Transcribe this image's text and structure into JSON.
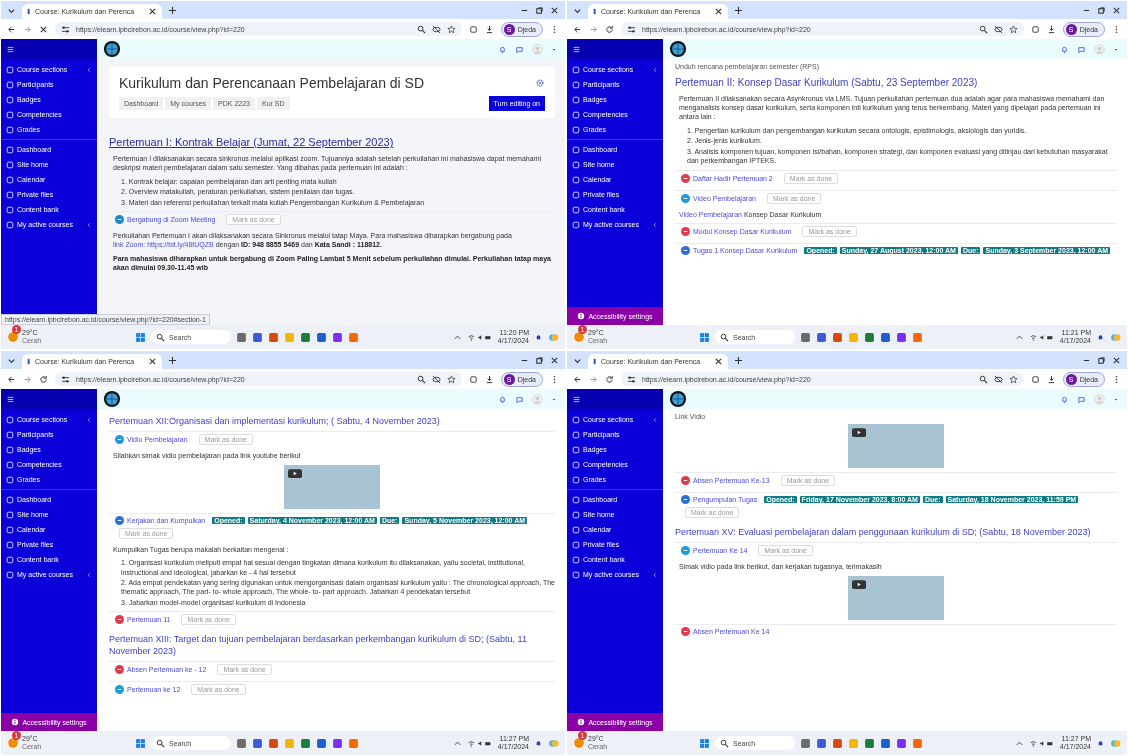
{
  "screens": [
    {
      "tab_title": "Course: Kurikulum dan Perenca",
      "loading": true,
      "url": "https://elearn.ipbcirebon.ac.id/course/view.php?id=220",
      "profile_initial": "S",
      "profile": "Djeda",
      "sidebar": [
        {
          "label": "Course sections",
          "expandable": true
        },
        {
          "label": "Participants",
          "expandable": false
        },
        {
          "label": "Badges",
          "expandable": false
        },
        {
          "label": "Competencies",
          "expandable": false
        },
        {
          "label": "Grades",
          "expandable": false
        },
        {
          "label": "Dashboard",
          "expandable": false
        },
        {
          "label": "Site home",
          "expandable": false
        },
        {
          "label": "Calendar",
          "expandable": false
        },
        {
          "label": "Private files",
          "expandable": false
        },
        {
          "label": "Content bank",
          "expandable": false
        },
        {
          "label": "My active courses",
          "expandable": true
        }
      ],
      "blocks": [
        {
          "kind": "course-header",
          "title": "Kurikulum dan Perencanaan Pembelajaran di SD",
          "breadcrumbs": [
            "Dashboard",
            "My courses",
            "PDK 2223",
            "Kur SD"
          ],
          "button": "Turn editing on"
        },
        {
          "kind": "section-title",
          "text": "Pertemuan I: Kontrak Belajar (Jumat, 22 September 2023)",
          "underlined": true
        },
        {
          "kind": "paragraph",
          "parts": [
            {
              "text": "Pertemuan I dilaksanakan secara sinkronus melalui aplikasi zoom. Tujuannya adalah setelah perkuliahan ini mahasiswa dapat memahami deskripsi materi pembelajaran dalam satu semester. Yang dibahas pada pertemuan ini adalah :",
              "kind": "plain"
            }
          ]
        },
        {
          "kind": "list",
          "items": [
            {
              "number": "1.",
              "text": "Kontrak belajar: capaian pembelajaran dan arti penting mata kuliah"
            },
            {
              "number": "2.",
              "text": "Overview matakuliah, peraturan perkuliahan, sistem penilaian dan tugas."
            },
            {
              "number": "3.",
              "text": "Materi dan referensi perkuliahan terkait mata kuliah Pengembangan Kurikulum & Pembelajaran"
            }
          ]
        },
        {
          "kind": "activity",
          "name": "Bergabung di Zoom Meeting",
          "color": "#1e88c9",
          "mark_done": "Mark as done"
        },
        {
          "kind": "paragraph",
          "parts": [
            {
              "text": "Perkuliahan Pertemuan I akan dilaksanakan secara Sinkronus melalui tatap Maya. Para mahasiswa diharapkan bergabung pada",
              "kind": "plain"
            },
            {
              "text": "link Zoom: https://bit.ly/48tUQZB",
              "kind": "link"
            },
            {
              "text": "dengan",
              "kind": "plain"
            },
            {
              "text": "ID: 948 8855 5469",
              "kind": "bold"
            },
            {
              "text": "dan",
              "kind": "plain"
            },
            {
              "text": "Kata Sandi : 118812.",
              "kind": "bold"
            }
          ]
        },
        {
          "kind": "paragraph",
          "parts": [
            {
              "text": "Para mahasiswa diharapkan untuk bergabung di Zoom Paling Lambat 5 Menit sebelum perkuliahan dimulai. Perkuliahan tatap maya akan dimulai 09.30-11.45 wib",
              "kind": "bold"
            }
          ]
        }
      ],
      "status_url": "https://elearn.ipbcirebon.ac.id/course/view.php?id=220#section-1",
      "taskbar": {
        "weather_badge": "1",
        "temp": "29°C",
        "weather": "Cerah",
        "search": "Search",
        "time": "11:20 PM",
        "date": "4/17/2024"
      }
    },
    {
      "tab_title": "Course: Kurikulum dan Perenca",
      "loading": false,
      "url": "https://elearn.ipbcirebon.ac.id/course/view.php?id=220",
      "profile_initial": "S",
      "profile": "Djeda",
      "sidebar": [
        {
          "label": "Course sections",
          "expandable": true
        },
        {
          "label": "Participants",
          "expandable": false
        },
        {
          "label": "Badges",
          "expandable": false
        },
        {
          "label": "Competencies",
          "expandable": false
        },
        {
          "label": "Grades",
          "expandable": false
        },
        {
          "label": "Dashboard",
          "expandable": false
        },
        {
          "label": "Site home",
          "expandable": false
        },
        {
          "label": "Calendar",
          "expandable": false
        },
        {
          "label": "Private files",
          "expandable": false
        },
        {
          "label": "Content bank",
          "expandable": false
        },
        {
          "label": "My active courses",
          "expandable": true
        }
      ],
      "accessibility": "Accessibility settings",
      "blocks": [
        {
          "kind": "cut-line",
          "text": "Unduh rencana pembelajaran semester (RPS)"
        },
        {
          "kind": "section-title",
          "text": "Pertemuan II: Konsep Dasar Kurikulum (Sabtu, 23 September 2023)",
          "underlined": false
        },
        {
          "kind": "paragraph",
          "parts": [
            {
              "text": "Pertemuan II dilaksanakan secara Asynkronus via LMS. Tujuan perkuliahan pertemuan dua adalah agar para mahasiswa memahami dan menganalisis konsep dasar kurikulum, serta komponen inti kurikulum yang terus berkembang. Materi yang dipelajari pada pertemuan ini antara lain :",
              "kind": "plain"
            }
          ]
        },
        {
          "kind": "list",
          "items": [
            {
              "number": "1.",
              "text": "Pengertian kurikulum dan pengembangan kurikulum secara ontologis, epistimologis, aksiologis dan yuridis."
            },
            {
              "number": "2.",
              "text": "Jenis-jenis kurikulum."
            },
            {
              "number": "3.",
              "text": "Analisis komponen tujuan, komponen isi/bahan, komponen strategi, dan komponen evaluasi yang ditinjau dari kebutuhan masyarakat dan perkembangan IPTEKS."
            }
          ]
        },
        {
          "kind": "activity",
          "name": "Daftar Hadir Pertemuan 2",
          "color": "#e2394c",
          "mark_done": "Mark as done"
        },
        {
          "kind": "activity",
          "name": "Video Pembelajaran",
          "color": "#1e9bd7",
          "mark_done": "Mark as done"
        },
        {
          "kind": "paragraph",
          "parts": [
            {
              "text": "Video Pembelajaran",
              "kind": "link"
            },
            {
              "text": "Konsep Dasar Kurikulum",
              "kind": "plain"
            }
          ]
        },
        {
          "kind": "activity",
          "name": "Modul Konsep Dasar Kurikulum",
          "color": "#e2394c",
          "mark_done": "Mark as done"
        },
        {
          "kind": "activity",
          "name": "Tugas 1 Konsep Dasar Kurikulum",
          "color": "#2a6fd6",
          "dates": [
            {
              "label": "Opened:",
              "value": "Sunday, 27 August 2023, 12:00 AM"
            },
            {
              "label": "Due:",
              "value": "Sunday, 3 September 2023, 12:00 AM"
            }
          ]
        }
      ],
      "taskbar": {
        "weather_badge": "1",
        "temp": "29°C",
        "weather": "Cerah",
        "search": "Search",
        "time": "11:21 PM",
        "date": "4/17/2024"
      }
    },
    {
      "tab_title": "Course: Kurikulum dan Perenca",
      "loading": false,
      "url": "https://elearn.ipbcirebon.ac.id/course/view.php?id=220",
      "profile_initial": "S",
      "profile": "Djeda",
      "sidebar": [
        {
          "label": "Course sections",
          "expandable": true
        },
        {
          "label": "Participants",
          "expandable": false
        },
        {
          "label": "Badges",
          "expandable": false
        },
        {
          "label": "Competencies",
          "expandable": false
        },
        {
          "label": "Grades",
          "expandable": false
        },
        {
          "label": "Dashboard",
          "expandable": false
        },
        {
          "label": "Site home",
          "expandable": false
        },
        {
          "label": "Calendar",
          "expandable": false
        },
        {
          "label": "Private files",
          "expandable": false
        },
        {
          "label": "Content bank",
          "expandable": false
        },
        {
          "label": "My active courses",
          "expandable": true
        }
      ],
      "accessibility": "Accessibility settings",
      "blocks": [
        {
          "kind": "section-title",
          "text": "Pertemuan XII:Organisasi dan implementasi kurikulum; ( Sabtu, 4 November 2023)",
          "underlined": false
        },
        {
          "kind": "activity",
          "name": "Vidio Pembelajaran",
          "color": "#1e9bd7",
          "mark_done": "Mark as done"
        },
        {
          "kind": "paragraph",
          "parts": [
            {
              "text": "Silahkan simak vidio pembelajaran pada link youtube berikut",
              "kind": "plain"
            }
          ]
        },
        {
          "kind": "video"
        },
        {
          "kind": "activity",
          "name": "Kerjakan dan Kumpulkan",
          "color": "#2a6fd6",
          "dates": [
            {
              "label": "Opened:",
              "value": "Saturday, 4 November 2023, 12:00 AM"
            },
            {
              "label": "Due:",
              "value": "Sunday, 5 November 2023, 12:00 AM"
            }
          ],
          "mark_done": "Mark as done"
        },
        {
          "kind": "paragraph",
          "parts": [
            {
              "text": "Kumpulkan Tugas berupa makalah berkaitan mengenai :",
              "kind": "plain"
            }
          ]
        },
        {
          "kind": "list",
          "items": [
            {
              "number": "1.",
              "text": "Organisasi kurikulum meliputi empat hal sesuai dengan tingkatan dimana kurikulum itu dilaksanakan, yaitu societal, institutional, instructional and ideological, jabarkan ke - 4 hal tersebut"
            },
            {
              "number": "2.",
              "text": "Ada empat pendekatan yang sering digunakan untuk mengorganisasi dalam organisasi kurikulum yaitu : The chronological approach, The thematic approach, The part- to- whole approach, The whole- to- part approach. Jabarkan 4 pendekatan tersebut"
            },
            {
              "number": "3.",
              "text": "Jabarkan model-model organisasi kurikulum di Indonesia"
            }
          ]
        },
        {
          "kind": "activity",
          "name": "Pertemuan 11",
          "color": "#e2394c",
          "mark_done": "Mark as done"
        },
        {
          "kind": "section-title",
          "text": "Pertemuan XIII: Target dan tujuan pembelajaran berdasarkan perkembangan kurikulum di SD; (Sabtu, 11 November 2023)",
          "underlined": false
        },
        {
          "kind": "activity",
          "name": "Absen Pertemuan ke - 12",
          "color": "#e2394c",
          "mark_done": "Mark as done"
        },
        {
          "kind": "activity",
          "name": "Pertemuan ke 12",
          "color": "#1e9bd7",
          "mark_done": "Mark as done"
        }
      ],
      "taskbar": {
        "weather_badge": "1",
        "temp": "29°C",
        "weather": "Cerah",
        "search": "Search",
        "time": "11:27 PM",
        "date": "4/17/2024"
      }
    },
    {
      "tab_title": "Course: Kurikulum dan Perenca",
      "loading": false,
      "url": "https://elearn.ipbcirebon.ac.id/course/view.php?id=220",
      "profile_initial": "S",
      "profile": "Djeda",
      "sidebar": [
        {
          "label": "Course sections",
          "expandable": true
        },
        {
          "label": "Participants",
          "expandable": false
        },
        {
          "label": "Badges",
          "expandable": false
        },
        {
          "label": "Competencies",
          "expandable": false
        },
        {
          "label": "Grades",
          "expandable": false
        },
        {
          "label": "Dashboard",
          "expandable": false
        },
        {
          "label": "Site home",
          "expandable": false
        },
        {
          "label": "Calendar",
          "expandable": false
        },
        {
          "label": "Private files",
          "expandable": false
        },
        {
          "label": "Content bank",
          "expandable": false
        },
        {
          "label": "My active courses",
          "expandable": true
        }
      ],
      "accessibility": "Accessibility settings",
      "blocks": [
        {
          "kind": "cut-line",
          "text": "Link Vidio"
        },
        {
          "kind": "video"
        },
        {
          "kind": "activity",
          "name": "Absen Pertemuan Ke-13",
          "color": "#e2394c",
          "mark_done": "Mark as done"
        },
        {
          "kind": "activity",
          "name": "Pengumpulan Tugas",
          "color": "#2a6fd6",
          "dates": [
            {
              "label": "Opened:",
              "value": "Friday, 17 November 2023, 8:00 AM"
            },
            {
              "label": "Due:",
              "value": "Saturday, 18 November 2023, 11:59 PM"
            }
          ],
          "mark_done": "Mark as done"
        },
        {
          "kind": "section-title",
          "text": "Pertemuan XV: Evaluasi pembelajaran dalam penggunaan kurikulum di SD; (Sabtu, 18 November 2023)",
          "underlined": false
        },
        {
          "kind": "activity",
          "name": "Pertemuan Ke 14",
          "color": "#1e9bd7",
          "mark_done": "Mark as done"
        },
        {
          "kind": "paragraph",
          "parts": [
            {
              "text": "Simak vidio pada link berikut, dan kerjakan tugasnya, terimakasih",
              "kind": "plain"
            }
          ]
        },
        {
          "kind": "video"
        },
        {
          "kind": "activity",
          "name": "Absen Pertemuan Ke 14",
          "color": "#e2394c"
        }
      ],
      "taskbar": {
        "weather_badge": "1",
        "temp": "29°C",
        "weather": "Cerah",
        "search": "Search",
        "time": "11:27 PM",
        "date": "4/17/2024"
      }
    }
  ]
}
